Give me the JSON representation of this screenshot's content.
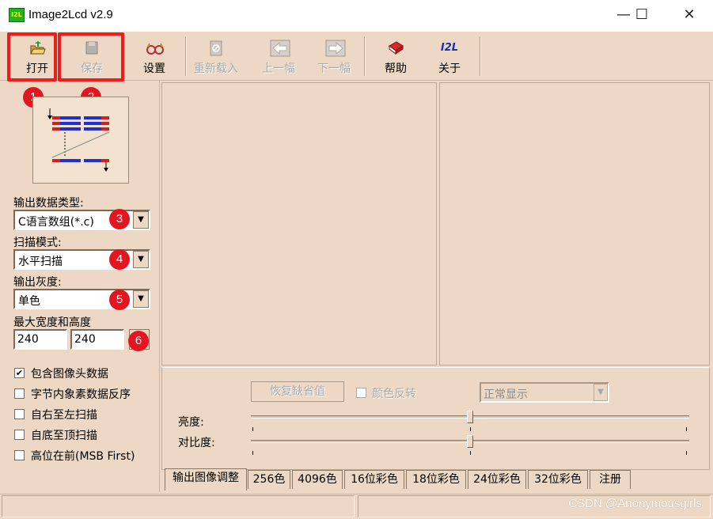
{
  "window": {
    "icon_text": "I2L",
    "title": "Image2Lcd v2.9",
    "controls": [
      "—",
      "☐",
      "✕"
    ]
  },
  "toolbar": {
    "open": "打开",
    "save": "保存",
    "settings": "设置",
    "reload": "重新载入",
    "prev": "上一幅",
    "next": "下一幅",
    "help": "帮助",
    "about": "关于",
    "about_icon_text": "I2L"
  },
  "badges": [
    "1",
    "2",
    "3",
    "4",
    "5",
    "6"
  ],
  "left": {
    "output_type_label": "输出数据类型:",
    "output_type_value": "C语言数组(*.c)",
    "scan_mode_label": "扫描模式:",
    "scan_mode_value": "水平扫描",
    "gray_label": "输出灰度:",
    "gray_value": "单色",
    "max_size_label": "最大宽度和高度",
    "width": "240",
    "height": "240",
    "options": [
      {
        "label": "包含图像头数据",
        "checked": true
      },
      {
        "label": "字节内象素数据反序",
        "checked": false
      },
      {
        "label": "自右至左扫描",
        "checked": false
      },
      {
        "label": "自底至顶扫描",
        "checked": false
      },
      {
        "label": "高位在前(MSB First)",
        "checked": false
      }
    ]
  },
  "adjust": {
    "restore_button": "恢复缺省值",
    "invert_label": "颜色反转",
    "display_mode": "正常显示",
    "brightness_label": "亮度:",
    "contrast_label": "对比度:",
    "brightness_level": 0.5,
    "contrast_level": 0.5
  },
  "tabs": [
    "输出图像调整",
    "256色",
    "4096色",
    "16位彩色",
    "18位彩色",
    "24位彩色",
    "32位彩色",
    "注册"
  ],
  "watermark": "CSDN @Anonymousgirls",
  "colors": {
    "accent_red": "#e3161f",
    "background": "#ecd8c4"
  }
}
